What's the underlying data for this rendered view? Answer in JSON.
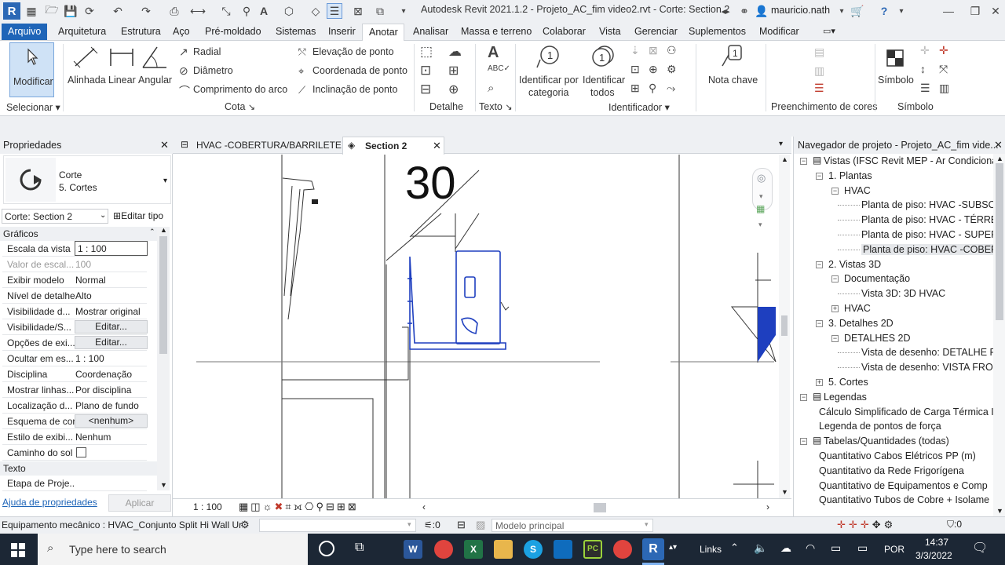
{
  "app": {
    "title": "Autodesk Revit 2021.1.2 - Projeto_AC_fim video2.rvt - Corte: Section 2",
    "user": "mauricio.nath"
  },
  "menu": {
    "items": [
      "Arquivo",
      "Arquitetura",
      "Estrutura",
      "Aço",
      "Pré-moldado",
      "Sistemas",
      "Inserir",
      "Anotar",
      "Analisar",
      "Massa e terreno",
      "Colaborar",
      "Vista",
      "Gerenciar",
      "Suplementos",
      "Modificar"
    ],
    "active": "Anotar"
  },
  "ribbon": {
    "modificar": "Modificar",
    "alinhada": "Alinhada",
    "linear": "Linear",
    "angular": "Angular",
    "radial": "Radial",
    "diametro": "Diâmetro",
    "comprimento_arco": "Comprimento do arco",
    "elevacao_ponto": "Elevação de ponto",
    "coordenada_ponto": "Coordenada de ponto",
    "inclinacao_ponto": "Inclinação de ponto",
    "identificar_categoria_1": "Identificar por",
    "identificar_categoria_2": "categoria",
    "identificar_todos_1": "Identificar",
    "identificar_todos_2": "todos",
    "nota_chave": "Nota chave",
    "simbolo": "Símbolo",
    "panels": {
      "selecionar": "Selecionar",
      "cota": "Cota",
      "detalhe": "Detalhe",
      "texto": "Texto",
      "identificador": "Identificador",
      "preenchimento": "Preenchimento de cores",
      "simbolo": "Símbolo"
    }
  },
  "properties": {
    "header": "Propriedades",
    "type_name": "Corte",
    "type_sub": "5. Cortes",
    "selector": "Corte: Section 2",
    "edit_type": "Editar tipo",
    "section_graficos": "Gráficos",
    "rows": [
      {
        "k": "Escala da vista",
        "v": "1 : 100"
      },
      {
        "k": "Valor de escal...",
        "v": "100"
      },
      {
        "k": "Exibir modelo",
        "v": "Normal"
      },
      {
        "k": "Nível de detalhe",
        "v": "Alto"
      },
      {
        "k": "Visibilidade d...",
        "v": "Mostrar original"
      },
      {
        "k": "Visibilidade/S...",
        "v": "Editar..."
      },
      {
        "k": "Opções de exi...",
        "v": "Editar..."
      },
      {
        "k": "Ocultar em es...",
        "v": "1 : 100"
      },
      {
        "k": "Disciplina",
        "v": "Coordenação"
      },
      {
        "k": "Mostrar linhas...",
        "v": "Por disciplina"
      },
      {
        "k": "Localização d...",
        "v": "Plano de fundo"
      },
      {
        "k": "Esquema de cor",
        "v": "<nenhum>"
      },
      {
        "k": "Estilo de exibi...",
        "v": "Nenhum"
      },
      {
        "k": "Caminho do sol",
        "v": ""
      }
    ],
    "section_texto": "Texto",
    "etapa": "Etapa de Proje...",
    "help_link": "Ajuda de propriedades",
    "apply": "Aplicar"
  },
  "tabs": [
    {
      "label": "HVAC -COBERTURA/BARRILETE",
      "active": false
    },
    {
      "label": "Section 2",
      "active": true
    }
  ],
  "canvas": {
    "level_label": "30"
  },
  "viewbar": {
    "scale": "1 : 100"
  },
  "navigator": {
    "header": "Navegador de projeto - Projeto_AC_fim vide...",
    "nodes": [
      {
        "label": "Vistas (IFSC Revit MEP - Ar Condicionad",
        "depth": 0,
        "box": "-"
      },
      {
        "label": "1. Plantas",
        "depth": 1,
        "box": "-"
      },
      {
        "label": "HVAC",
        "depth": 2,
        "box": "-"
      },
      {
        "label": "Planta de piso: HVAC -SUBSOLO",
        "depth": 3,
        "box": ""
      },
      {
        "label": "Planta de piso: HVAC - TÉRREO",
        "depth": 3,
        "box": ""
      },
      {
        "label": "Planta de piso: HVAC - SUPERIOR",
        "depth": 3,
        "box": ""
      },
      {
        "label": "Planta de piso: HVAC -COBERTURA",
        "depth": 3,
        "box": "",
        "selected": true
      },
      {
        "label": "2. Vistas 3D",
        "depth": 1,
        "box": "-"
      },
      {
        "label": "Documentação",
        "depth": 2,
        "box": "-"
      },
      {
        "label": "Vista 3D: 3D HVAC",
        "depth": 3,
        "box": ""
      },
      {
        "label": "HVAC",
        "depth": 2,
        "box": "+"
      },
      {
        "label": "3. Detalhes 2D",
        "depth": 1,
        "box": "-"
      },
      {
        "label": "DETALHES 2D",
        "depth": 2,
        "box": "-"
      },
      {
        "label": "Vista de desenho: DETALHE RED",
        "depth": 3,
        "box": ""
      },
      {
        "label": "Vista de desenho: VISTA FRONT",
        "depth": 3,
        "box": ""
      },
      {
        "label": "5. Cortes",
        "depth": 1,
        "box": "+"
      },
      {
        "label": "Legendas",
        "depth": 0,
        "box": "-"
      },
      {
        "label": "Cálculo Simplificado de Carga Térmica I",
        "depth": 1,
        "box": ""
      },
      {
        "label": "Legenda de pontos de força",
        "depth": 1,
        "box": ""
      },
      {
        "label": "Tabelas/Quantidades (todas)",
        "depth": 0,
        "box": "-"
      },
      {
        "label": "Quantitativo Cabos Elétricos PP (m)",
        "depth": 1,
        "box": ""
      },
      {
        "label": "Quantitativo da Rede Frigorígena",
        "depth": 1,
        "box": ""
      },
      {
        "label": "Quantitativo de Equipamentos e Comp",
        "depth": 1,
        "box": ""
      },
      {
        "label": "Quantitativo Tubos de Cobre + Isolame",
        "depth": 1,
        "box": ""
      }
    ]
  },
  "status": {
    "selection": "Equipamento mecânico : HVAC_Conjunto Split Hi Wall Ur",
    "workset_count": ":0",
    "model": "Modelo principal",
    "filter_count": ":0"
  },
  "taskbar": {
    "search_placeholder": "Type here to search",
    "links": "Links",
    "lang": "POR",
    "time": "14:37",
    "date": "3/3/2022"
  },
  "colors": {
    "accent": "#1f65b8",
    "element_blue": "#1e3fbf",
    "taskbar": "#1c2735"
  }
}
